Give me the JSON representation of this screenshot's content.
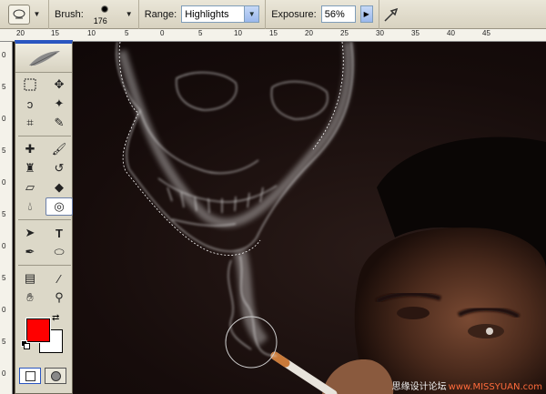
{
  "options_bar": {
    "brush_label": "Brush:",
    "brush_size": "176",
    "range_label": "Range:",
    "range_value": "Highlights",
    "exposure_label": "Exposure:",
    "exposure_value": "56%",
    "icons": [
      "dodge-tool-icon",
      "airbrush-icon"
    ]
  },
  "ruler": {
    "top_labels": [
      "20",
      "15",
      "10",
      "5",
      "0",
      "5",
      "10",
      "15",
      "20",
      "25",
      "30",
      "35",
      "40",
      "45"
    ],
    "left_labels": [
      "0",
      "5",
      "0",
      "5",
      "0",
      "5",
      "0",
      "5",
      "0",
      "5",
      "0"
    ]
  },
  "toolbox": {
    "foreground_color": "#ff0000",
    "background_color": "#ffffff",
    "tools": [
      "marquee-icon",
      "move-icon",
      "lasso-icon",
      "magic-wand-icon",
      "crop-icon",
      "slice-icon",
      "healing-icon",
      "brush-icon",
      "stamp-icon",
      "history-brush-icon",
      "eraser-icon",
      "paint-bucket-icon",
      "blur-icon",
      "dodge-icon",
      "path-select-icon",
      "type-icon",
      "pen-icon",
      "shape-icon",
      "notes-icon",
      "eyedropper-icon",
      "hand-icon",
      "zoom-icon"
    ],
    "active_tool": "dodge-icon"
  },
  "watermark": {
    "prefix": "思缘设计论坛",
    "site": "www.MISSYUAN.com"
  },
  "colors": {
    "accent": "#2a55c0",
    "toolbar_bg": "#dcd8c8",
    "canvas_bg": "#160c0b"
  }
}
